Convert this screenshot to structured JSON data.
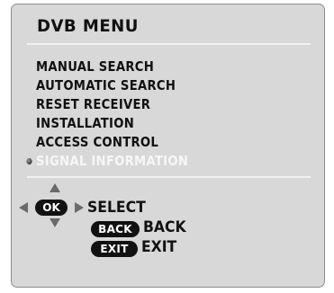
{
  "menu": {
    "title": "DVB MENU",
    "items": [
      {
        "label": "MANUAL SEARCH",
        "selected": false
      },
      {
        "label": "AUTOMATIC SEARCH",
        "selected": false
      },
      {
        "label": "RESET RECEIVER",
        "selected": false
      },
      {
        "label": "INSTALLATION",
        "selected": false
      },
      {
        "label": "ACCESS CONTROL",
        "selected": false
      },
      {
        "label": "SIGNAL INFORMATION",
        "selected": true
      }
    ]
  },
  "legend": {
    "ok_key": "OK",
    "select_label": "SELECT",
    "back_key": "BACK",
    "back_label": "BACK",
    "exit_key": "EXIT",
    "exit_label": "EXIT"
  },
  "colors": {
    "panel_background": "#d8d8d8",
    "text": "#111111",
    "selected_text": "#f6f6f6",
    "divider": "#f4f4f4",
    "arrow": "#6a6a6a",
    "key_background": "#111111"
  },
  "icons": {
    "selection_marker": "bullet-icon",
    "navigation": [
      "arrow-up-icon",
      "arrow-down-icon",
      "arrow-left-icon",
      "arrow-right-icon"
    ]
  }
}
